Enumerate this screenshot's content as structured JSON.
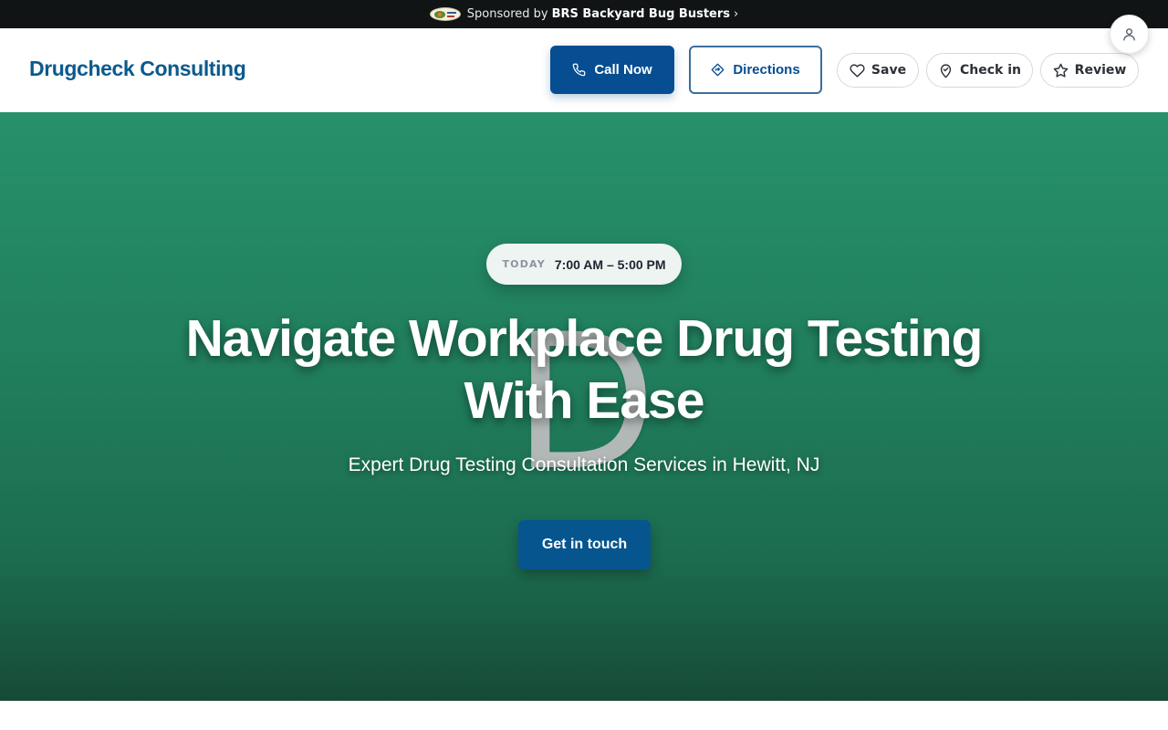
{
  "sponsor": {
    "prefix": "Sponsored by",
    "name": "BRS Backyard Bug Busters",
    "chevron": "›"
  },
  "account": {
    "icon": "user-icon"
  },
  "header": {
    "brand": "Drugcheck Consulting",
    "call_label": "Call Now",
    "directions_label": "Directions",
    "save_label": "Save",
    "checkin_label": "Check in",
    "review_label": "Review"
  },
  "hero": {
    "hours_label": "TODAY",
    "hours_value": "7:00 AM – 5:00 PM",
    "title_line1": "Navigate Workplace Drug Testing",
    "title_line2": "With Ease",
    "subtitle": "Expert Drug Testing Consultation Services in Hewitt, NJ",
    "watermark": "D",
    "cta_label": "Get in touch"
  },
  "icons": {
    "call": "phone-icon",
    "directions": "directions-icon",
    "save": "heart-icon",
    "checkin": "map-pin-icon",
    "review": "star-icon"
  },
  "colors": {
    "brand": "#0b5a8e",
    "primary_button": "#064d91",
    "hero_green": "#26916b",
    "hero_dark": "#164a37",
    "sponsor_bar": "#101414"
  }
}
